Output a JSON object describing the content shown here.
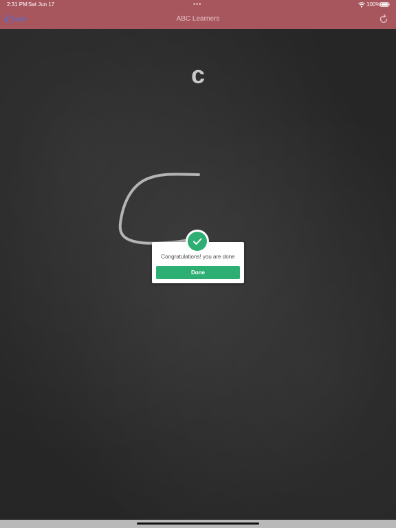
{
  "status_bar": {
    "time": "2:31 PM",
    "date": "Sat Jun 17",
    "battery": "100%",
    "dots": "•••"
  },
  "nav": {
    "back_label": "Back",
    "title": "ABC Learners",
    "back_icon": "chevron-left-icon",
    "refresh_icon": "refresh-icon"
  },
  "lesson": {
    "letter": "c"
  },
  "dialog": {
    "message": "Congratulations! you are done",
    "done_label": "Done",
    "badge_icon": "checkmark-icon"
  },
  "colors": {
    "header": "#a8565e",
    "accent": "#2dae72",
    "back_link": "#4f6fd8",
    "chalk": "#c8c8c8"
  }
}
